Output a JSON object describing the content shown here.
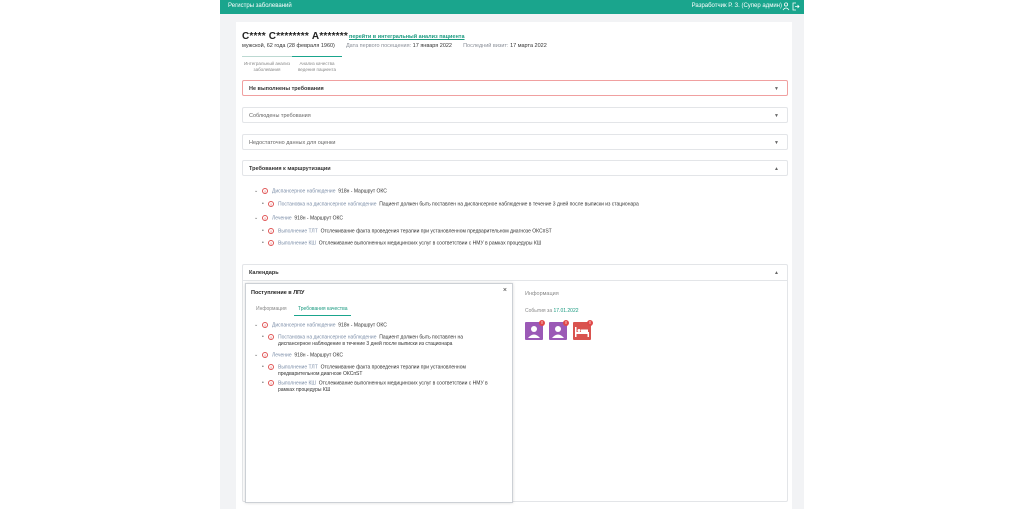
{
  "topbar": {
    "brand": "Регистры заболеваний",
    "user": "Разработчик Р. З. (Супер админ)",
    "icons": [
      "user-icon",
      "logout-icon"
    ]
  },
  "patient": {
    "name": "С**** С******** А*******",
    "link": "перейти в интегральный анализ пациента",
    "demographics": "мужской, 62 года (28 февраля 1960)",
    "first_visit_label": "Дата первого посещения:",
    "first_visit_value": "17 января 2022",
    "last_visit_label": "Последний визит:",
    "last_visit_value": "17 марта 2022"
  },
  "tabs": [
    {
      "label": "Интегральный анализ заболевания"
    },
    {
      "label": "Анализ качества ведения пациента"
    }
  ],
  "accordions": [
    {
      "title": "Не выполнены требования"
    },
    {
      "title": "Соблюдены требования"
    },
    {
      "title": "Недостаточно данных для оценки"
    },
    {
      "title": "Требования к маршрутизации"
    }
  ],
  "routing": {
    "items": [
      {
        "link": "Диспансерное наблюдение",
        "text": "918н - Маршрут ОКС"
      },
      {
        "link": "Постановка на диспансерное наблюдение",
        "text": "Пациент должен быть поставлен на диспансерное наблюдение в течение 3 дней после выписки из стационара"
      },
      {
        "link": "Лечение",
        "text": "918н - Маршрут ОКС"
      },
      {
        "link": "Выполнение ТЛТ",
        "text": "Отслеживание факта проведения терапии при установленном предварительном диагнозе ОКСпST"
      },
      {
        "link": "Выполнение КШ",
        "text": "Отслеживание выполненных медицинских услуг в соответствии с НМУ в рамках процедуры КШ"
      }
    ]
  },
  "calendar": {
    "title": "Календарь",
    "modal": {
      "title": "Поступление в ЛПУ",
      "close": "×",
      "tabs": [
        "Информация",
        "Требования качества"
      ],
      "items": [
        {
          "link": "Диспансерное наблюдение",
          "text": "918н - Маршрут ОКС"
        },
        {
          "link": "Постановка на диспансерное наблюдение",
          "text1": "Пациент должен быть поставлен на",
          "text2": "диспансерное наблюдение в течение 3 дней после выписки из стационара"
        },
        {
          "link": "Лечение",
          "text": "918н - Маршрут ОКС"
        },
        {
          "link": "Выполнение ТЛТ",
          "text1": "Отслеживание факта проведения терапии при установленном",
          "text2": "предварительном диагнозе ОКСпST"
        },
        {
          "link": "Выполнение КШ",
          "text1": "Отслеживание выполненных медицинских услуг в соответствии с НМУ в",
          "text2": "рамках процедуры КШ"
        }
      ]
    },
    "info_label": "Информация",
    "events_label": "События за",
    "events_date": "17.01.2022",
    "event_icons": [
      {
        "icon": "doctor-icon",
        "color": "#9b59b6",
        "badge": "!"
      },
      {
        "icon": "doctor-icon",
        "color": "#9b59b6",
        "badge": "!"
      },
      {
        "icon": "hospital-bed-icon",
        "color": "#d9534f",
        "badge": "!"
      }
    ]
  }
}
